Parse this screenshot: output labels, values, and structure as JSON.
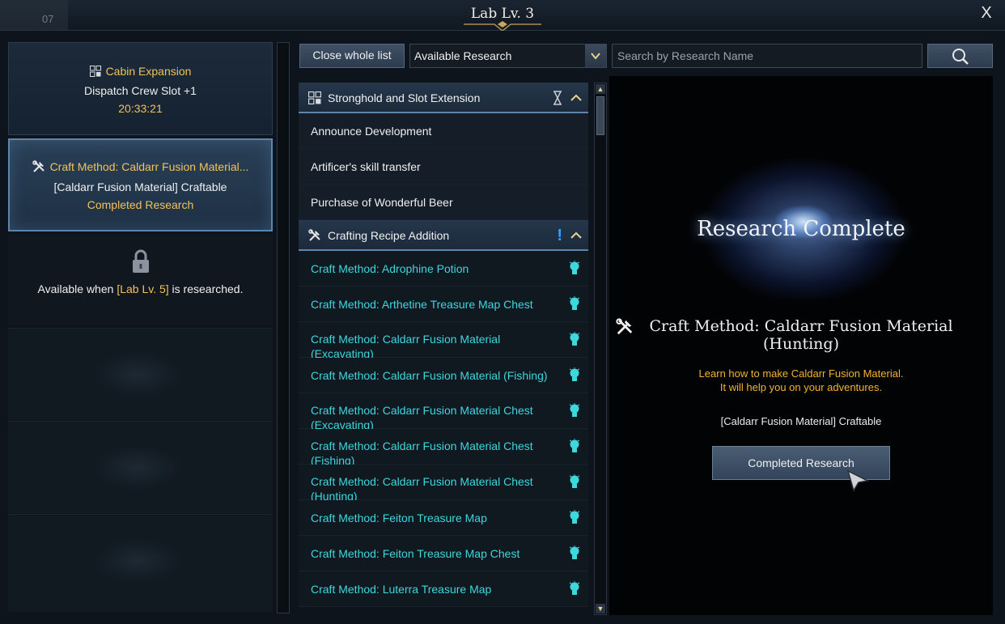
{
  "window": {
    "title": "Lab Lv. 3",
    "counter": "07",
    "close_label": "X"
  },
  "slots": [
    {
      "icon": "grid-icon",
      "title": "Cabin Expansion",
      "effect": "Dispatch Crew Slot +1",
      "timer": "20:33:21"
    },
    {
      "icon": "tools-icon",
      "title": "Craft Method: Caldarr Fusion Material...",
      "effect": "[Caldarr Fusion Material] Craftable",
      "status": "Completed Research"
    },
    {
      "icon": "lock-icon",
      "locked_prefix": "Available when ",
      "locked_req": "[Lab Lv. 5]",
      "locked_suffix": " is researched."
    }
  ],
  "toolbar": {
    "close_list_label": "Close whole list",
    "filter_selected": "Available Research",
    "search_placeholder": "Search by Research Name"
  },
  "categories": [
    {
      "icon": "grid-icon",
      "name": "Stronghold and Slot Extension",
      "status_icon": "hourglass-icon",
      "items": [
        "Announce Development",
        "Artificer's skill transfer",
        "Purchase of Wonderful Beer"
      ]
    },
    {
      "icon": "tools-icon",
      "name": "Crafting Recipe Addition",
      "status_icon": "exclamation-icon",
      "status_text": "!",
      "items": [
        "Craft Method: Adrophine Potion",
        "Craft Method: Arthetine Treasure Map Chest",
        "Craft Method: Caldarr Fusion Material (Excavating)",
        "Craft Method: Caldarr Fusion Material (Fishing)",
        "Craft Method: Caldarr Fusion Material Chest (Excavating)",
        "Craft Method: Caldarr Fusion Material Chest (Fishing)",
        "Craft Method: Caldarr Fusion Material Chest (Hunting)",
        "Craft Method: Feiton Treasure Map",
        "Craft Method: Feiton Treasure Map Chest",
        "Craft Method: Luterra Treasure Map"
      ]
    }
  ],
  "detail": {
    "banner": "Research Complete",
    "title": "Craft Method: Caldarr Fusion Material (Hunting)",
    "desc_line1": "Learn how to make Caldarr Fusion Material.",
    "desc_line2": "It will help you on your adventures.",
    "effect": "[Caldarr Fusion Material] Craftable",
    "button_label": "Completed Research"
  },
  "colors": {
    "gold": "#f1c25a",
    "teal": "#3ed7dd",
    "accent_blue": "#5d86ac",
    "desc_orange": "#f1b430"
  }
}
